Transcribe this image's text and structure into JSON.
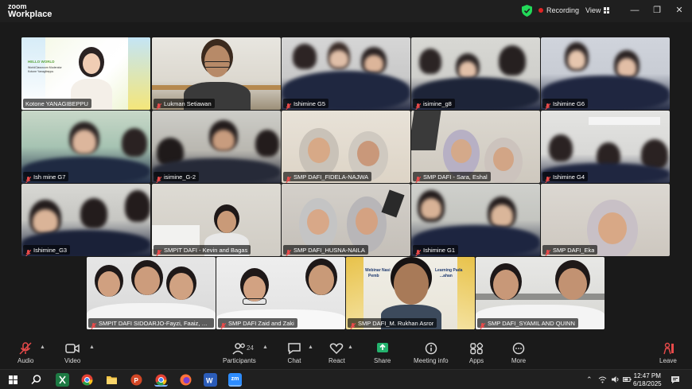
{
  "app": {
    "brand_line1": "zoom",
    "brand_line2": "Workplace"
  },
  "titlebar": {
    "recording_label": "Recording",
    "view_label": "View",
    "minimize": "—",
    "restore": "❐",
    "close": "✕"
  },
  "tiles": [
    {
      "name": "Kotone YANAGIBEPPU",
      "muted": false
    },
    {
      "name": "Lukman Setiawan",
      "muted": true
    },
    {
      "name": "Ishimine G5",
      "muted": true
    },
    {
      "name": "isimine_g8",
      "muted": true
    },
    {
      "name": "Ishimine G6",
      "muted": true
    },
    {
      "name": "Ish mine G7",
      "muted": true
    },
    {
      "name": "isimine_G-2",
      "muted": true
    },
    {
      "name": "SMP DAFI_FIDELA-NAJWA",
      "muted": true
    },
    {
      "name": "SMP DAFI - Sara, Eshal",
      "muted": true
    },
    {
      "name": "Ishimine G4",
      "muted": true
    },
    {
      "name": "Ishimine_G3",
      "muted": true
    },
    {
      "name": "SMPIT DAFI - Kevin and Bagas",
      "muted": true
    },
    {
      "name": "SMP DAFI_HUSNA-NAILA",
      "muted": true
    },
    {
      "name": "Ishimine G1",
      "muted": true
    },
    {
      "name": "SMP DAFI_Eka",
      "muted": true
    },
    {
      "name": "SMPIT DAFI SIDOARJO-Fayzi, Faaiz, He...",
      "muted": true
    },
    {
      "name": "SMP DAFI Zaid and Zaki",
      "muted": true
    },
    {
      "name": "SMP DAFI_M. Rukhan Asror",
      "muted": true
    },
    {
      "name": "SMP DAFI_SYAMIL AND QUINN",
      "muted": true
    }
  ],
  "slide_text": {
    "brand": "HELLO WORLD",
    "line1": "WorldClassroom Moderator",
    "line2": "Kotone Yanagibeppu",
    "webinar1": "Webinar Nasi",
    "webinar2": "Learning Pada",
    "webinar3": "Pemb",
    "webinar4": "...ahan"
  },
  "toolbar": {
    "audio": "Audio",
    "video": "Video",
    "participants": "Participants",
    "participant_count": "24",
    "chat": "Chat",
    "react": "React",
    "share": "Share",
    "meeting_info": "Meeting info",
    "apps": "Apps",
    "more": "More",
    "leave": "Leave"
  },
  "taskbar": {
    "time": "12:47 PM",
    "date": "6/18/2025",
    "zoom_app": "zm"
  },
  "colors": {
    "active_speaker": "#23d959",
    "muted_mic": "#e84a4a",
    "share": "#23b26d",
    "leave": "#e84a4a"
  }
}
